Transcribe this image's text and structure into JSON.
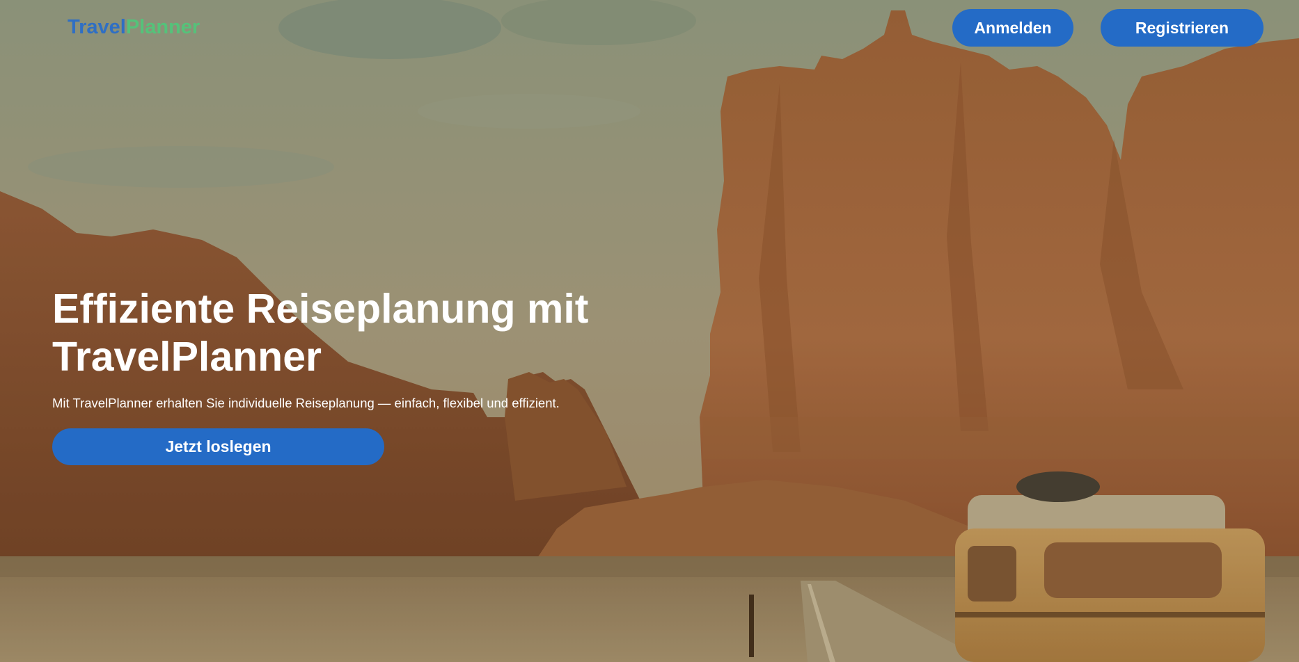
{
  "header": {
    "logo_part1": "Travel",
    "logo_part2": "Planner",
    "login_label": "Anmelden",
    "register_label": "Registrieren"
  },
  "hero": {
    "title_line1": "Effiziente Reiseplanung mit",
    "title_line2": "TravelPlanner",
    "subtitle": "Mit TravelPlanner erhalten Sie individuelle Reiseplanung — einfach, flexibel und effizient.",
    "cta_label": "Jetzt loslegen"
  },
  "colors": {
    "brand_blue": "#2f6fc4",
    "brand_green": "#55c27a",
    "button_blue": "#246bc6",
    "text_white": "#ffffff"
  }
}
